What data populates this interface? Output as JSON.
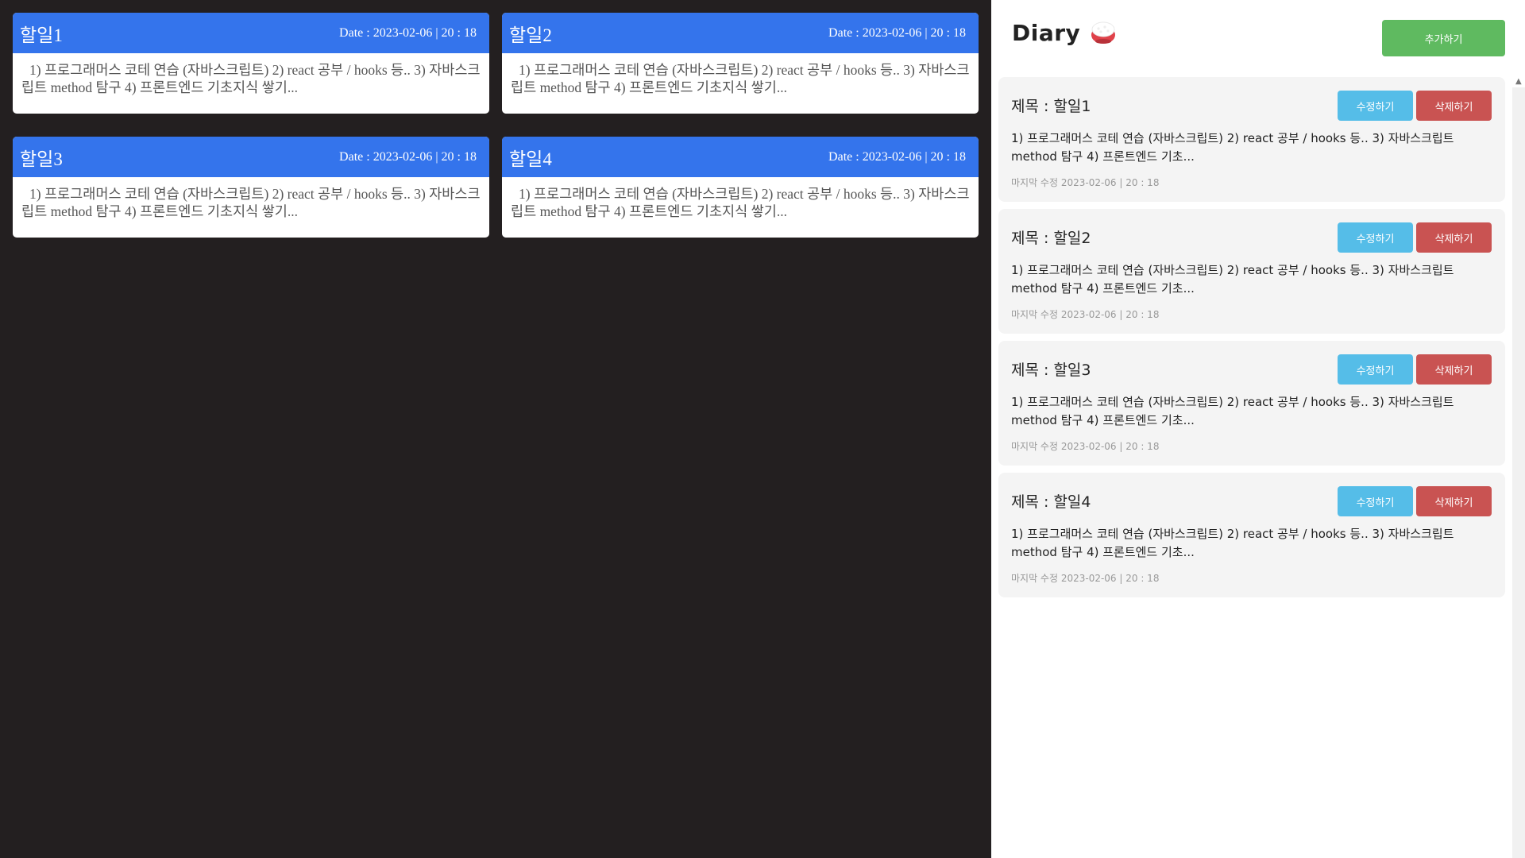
{
  "board": {
    "cards": [
      {
        "title": "할일1",
        "date": "Date : 2023-02-06 | 20 : 18",
        "body": "1) 프로그래머스 코테 연습 (자바스크립트) 2) react 공부 / hooks 등.. 3) 자바스크립트 method 탐구 4) 프론트엔드 기초지식 쌓기..."
      },
      {
        "title": "할일2",
        "date": "Date : 2023-02-06 | 20 : 18",
        "body": "1) 프로그래머스 코테 연습 (자바스크립트) 2) react 공부 / hooks 등.. 3) 자바스크립트 method 탐구 4) 프론트엔드 기초지식 쌓기..."
      },
      {
        "title": "할일3",
        "date": "Date : 2023-02-06 | 20 : 18",
        "body": "1) 프로그래머스 코테 연습 (자바스크립트) 2) react 공부 / hooks 등.. 3) 자바스크립트 method 탐구 4) 프론트엔드 기초지식 쌓기..."
      },
      {
        "title": "할일4",
        "date": "Date : 2023-02-06 | 20 : 18",
        "body": "1) 프로그래머스 코테 연습 (자바스크립트) 2) react 공부 / hooks 등.. 3) 자바스크립트 method 탐구 4) 프론트엔드 기초지식 쌓기..."
      }
    ]
  },
  "panel": {
    "title": "Diary",
    "icon": "rice-bowl-icon",
    "add_label": "추가하기",
    "items": [
      {
        "title": "제목 : 할일1",
        "body": "1) 프로그래머스 코테 연습 (자바스크립트) 2) react 공부 / hooks 등.. 3) 자바스크립트 method 탐구 4) 프론트엔드 기초...",
        "meta": "마지막 수정 2023-02-06 | 20 : 18",
        "edit_label": "수정하기",
        "delete_label": "삭제하기"
      },
      {
        "title": "제목 : 할일2",
        "body": "1) 프로그래머스 코테 연습 (자바스크립트) 2) react 공부 / hooks 등.. 3) 자바스크립트 method 탐구 4) 프론트엔드 기초...",
        "meta": "마지막 수정 2023-02-06 | 20 : 18",
        "edit_label": "수정하기",
        "delete_label": "삭제하기"
      },
      {
        "title": "제목 : 할일3",
        "body": "1) 프로그래머스 코테 연습 (자바스크립트) 2) react 공부 / hooks 등.. 3) 자바스크립트 method 탐구 4) 프론트엔드 기초...",
        "meta": "마지막 수정 2023-02-06 | 20 : 18",
        "edit_label": "수정하기",
        "delete_label": "삭제하기"
      },
      {
        "title": "제목 : 할일4",
        "body": "1) 프로그래머스 코테 연습 (자바스크립트) 2) react 공부 / hooks 등.. 3) 자바스크립트 method 탐구 4) 프론트엔드 기초...",
        "meta": "마지막 수정 2023-02-06 | 20 : 18",
        "edit_label": "수정하기",
        "delete_label": "삭제하기"
      }
    ]
  },
  "colors": {
    "card_header": "#3474ec",
    "add_button": "#5fba60",
    "edit_button": "#55bde8",
    "delete_button": "#c95352",
    "board_background": "#231f20"
  }
}
